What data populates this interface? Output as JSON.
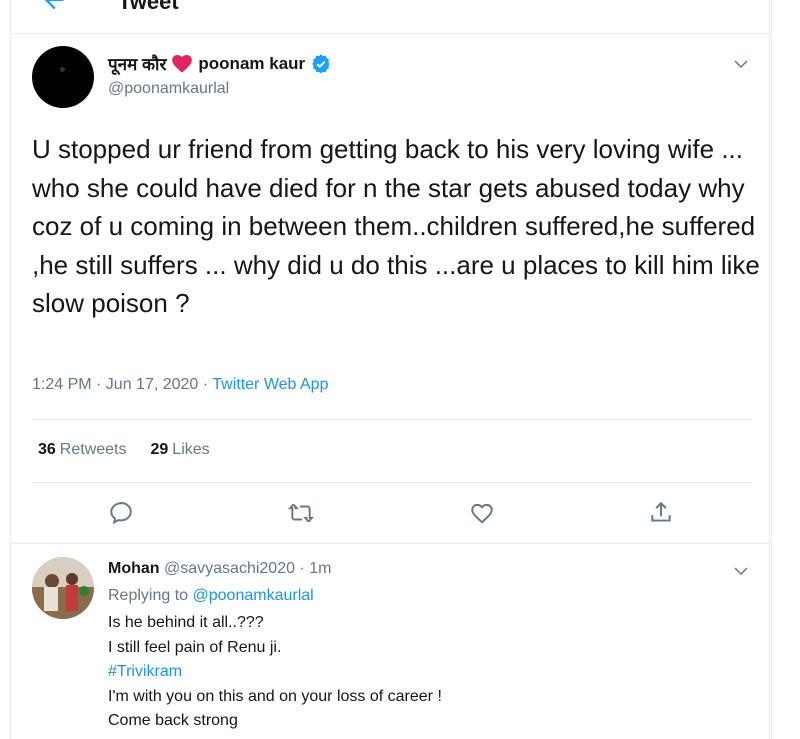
{
  "header": {
    "title": "Tweet",
    "back_icon": "arrow-left-icon"
  },
  "tweet": {
    "display_name": "पूनम कौर",
    "display_name_emoji": "heart-icon",
    "secondary_name": "poonam kaur",
    "verified_icon": "verified-badge-icon",
    "handle": "@poonamkaurlal",
    "text": "U stopped ur friend from getting back to his very loving wife ... who she could have died for n the star gets abused today why coz of u coming in between them..children suffered,he suffered ,he still suffers ... why did u do this ...are u places to kill him like slow poison ?",
    "time": "1:24 PM · Jun 17, 2020 · ",
    "source": "Twitter Web App",
    "retweets_count": "36",
    "retweets_label": "Retweets",
    "likes_count": "29",
    "likes_label": "Likes",
    "actions": [
      "reply-icon",
      "retweet-icon",
      "like-icon",
      "share-icon"
    ]
  },
  "reply": {
    "name": "Mohan",
    "handle": "@savyasachi2020",
    "time": "· 1m",
    "replying_prefix": "Replying to ",
    "replying_to": "@poonamkaurlal",
    "lines": [
      "Is he behind it all..???",
      "I still feel pain of Renu ji.",
      "#Trivikram",
      "I'm with you on this and on your loss of career !",
      "Come back strong"
    ]
  },
  "colors": {
    "link": "#1b95e0",
    "secondary_text": "#657786",
    "verified": "#1da1f2",
    "heart": "#e0245e"
  }
}
